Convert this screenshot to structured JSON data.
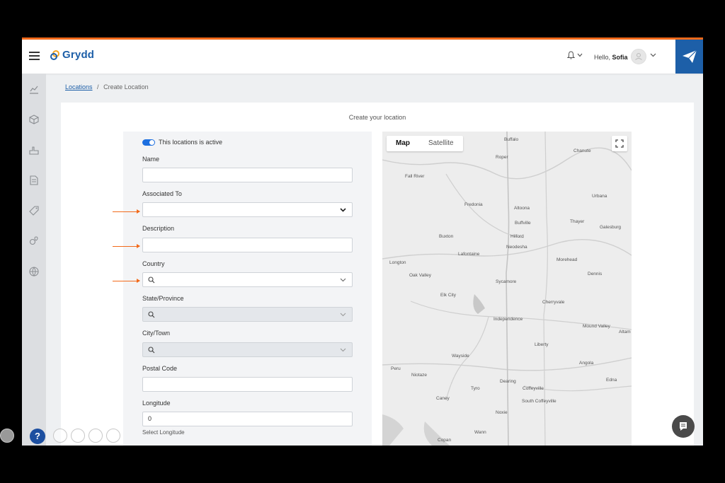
{
  "header": {
    "brand": "Grydd",
    "greeting_prefix": "Hello, ",
    "user_name": "Sofia"
  },
  "breadcrumb": {
    "parent": "Locations",
    "separator": "/",
    "current": "Create Location"
  },
  "card": {
    "title": "Create your location"
  },
  "form": {
    "active_toggle_label": "This locations is active",
    "name_label": "Name",
    "name_value": "",
    "associated_label": "Associated To",
    "associated_value": "",
    "description_label": "Description",
    "description_value": "",
    "country_label": "Country",
    "state_label": "State/Province",
    "city_label": "City/Town",
    "postal_label": "Postal Code",
    "postal_value": "",
    "longitude_label": "Longitude",
    "longitude_value": "0",
    "longitude_hint": "Select Longitude"
  },
  "map": {
    "tab_map": "Map",
    "tab_satellite": "Satellite",
    "towns": [
      "Buffalo",
      "Chanute",
      "Roper",
      "Fall River",
      "Urbana",
      "Fredonia",
      "Altoona",
      "Thayer",
      "Galesburg",
      "Buffville",
      "Buxton",
      "Hilford",
      "Lafontaine",
      "Neodesha",
      "Morehead",
      "Longton",
      "Dennis",
      "Oak Valley",
      "Sycamore",
      "Elk City",
      "Cherryvale",
      "Independence",
      "Mound Valley",
      "Altam",
      "Liberty",
      "Wayside",
      "Angola",
      "Peru",
      "Niotaze",
      "Dearing",
      "Edna",
      "Tyro",
      "Coffeyville",
      "Caney",
      "South Coffeyville",
      "Noxie",
      "Wann",
      "Copan"
    ]
  },
  "colors": {
    "brand_blue": "#1d5fa8",
    "accent_orange": "#f26a1b",
    "toggle_blue": "#1d6fe0"
  }
}
